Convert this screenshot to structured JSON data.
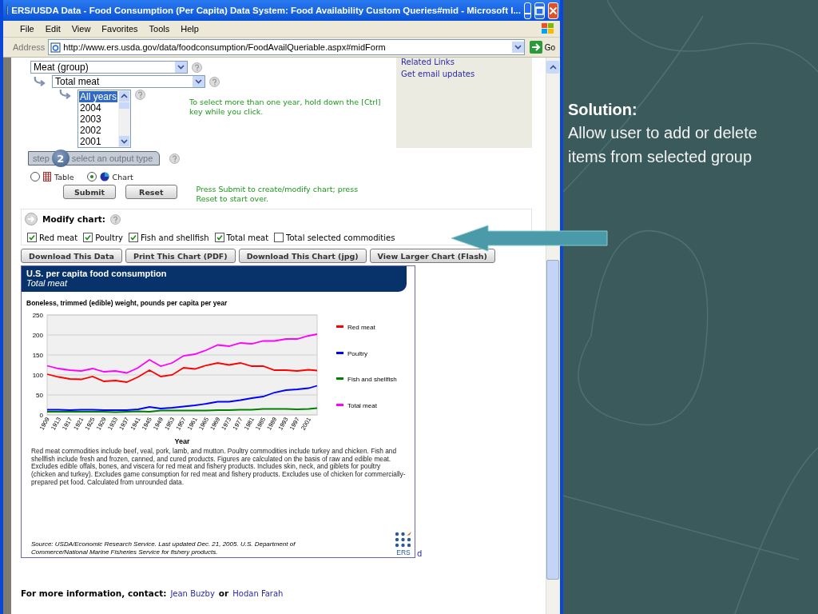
{
  "browser": {
    "title": "ERS/USDA Data - Food Consumption (Per Capita) Data System: Food Availability Custom Queries#mid - Microsoft I...",
    "menu": [
      "File",
      "Edit",
      "View",
      "Favorites",
      "Tools",
      "Help"
    ],
    "address_label": "Address",
    "url": "http://www.ers.usda.gov/data/foodconsumption/FoodAvailQueriable.aspx#midForm",
    "go_label": "Go"
  },
  "query": {
    "group_select": "Meat (group)",
    "commodity_select": "Total meat",
    "years": [
      {
        "label": "All years",
        "selected": true
      },
      {
        "label": "2004",
        "selected": false
      },
      {
        "label": "2003",
        "selected": false
      },
      {
        "label": "2002",
        "selected": false
      },
      {
        "label": "2001",
        "selected": false
      }
    ],
    "years_hint": "To select more than one year, hold down the [Ctrl] key while you click."
  },
  "sidebar_links": [
    "Related Links",
    "Get email updates"
  ],
  "step": {
    "word": "step",
    "number": "2",
    "label": "select an output type"
  },
  "output_types": [
    {
      "kind": "table",
      "label": "Table",
      "selected": false
    },
    {
      "kind": "chart",
      "label": "Chart",
      "selected": true
    }
  ],
  "form_buttons": [
    "Submit",
    "Reset"
  ],
  "submit_hint": "Press Submit to create/modify chart; press Reset to start over.",
  "modify_chart": {
    "title": "Modify chart:",
    "items": [
      {
        "label": "Red meat",
        "checked": true
      },
      {
        "label": "Poultry",
        "checked": true
      },
      {
        "label": "Fish and shellfish",
        "checked": true
      },
      {
        "label": "Total meat",
        "checked": true
      },
      {
        "label": "Total selected commodities",
        "checked": false
      }
    ]
  },
  "chart_buttons": [
    "Download This Data",
    "Print This Chart (PDF)",
    "Download This Chart (jpg)",
    "View Larger Chart (Flash)"
  ],
  "chart_card": {
    "title": "U.S. per capita food consumption",
    "subtitle": "Total meat",
    "unit_note": "Boneless, trimmed (edible) weight, pounds per capita per year",
    "chart_data": {
      "type": "line",
      "xlabel": "Year",
      "xlim": [
        1909,
        2004
      ],
      "grid": true,
      "legend": true,
      "x": [
        1909,
        1913,
        1917,
        1921,
        1925,
        1929,
        1933,
        1937,
        1941,
        1945,
        1949,
        1953,
        1957,
        1961,
        1965,
        1969,
        1973,
        1977,
        1981,
        1985,
        1989,
        1993,
        1997,
        2001,
        2004
      ],
      "ylim": [
        0,
        250
      ],
      "yticks": [
        0,
        50,
        100,
        150,
        200,
        250
      ],
      "xticks": [
        1909,
        1913,
        1917,
        1921,
        1925,
        1929,
        1933,
        1937,
        1941,
        1945,
        1949,
        1953,
        1957,
        1961,
        1965,
        1969,
        1973,
        1977,
        1981,
        1985,
        1989,
        1993,
        1997,
        2001
      ],
      "series": [
        {
          "name": "Red meat",
          "color": "#ff0000",
          "values": [
            102,
            95,
            90,
            89,
            96,
            84,
            86,
            82,
            95,
            112,
            96,
            100,
            118,
            115,
            124,
            130,
            125,
            130,
            122,
            122,
            112,
            112,
            110,
            113,
            111
          ]
        },
        {
          "name": "Poultry",
          "color": "#0000ff",
          "values": [
            13,
            13,
            12,
            13,
            13,
            12,
            12,
            12,
            14,
            20,
            16,
            18,
            21,
            24,
            28,
            33,
            33,
            37,
            42,
            46,
            56,
            62,
            64,
            67,
            73
          ]
        },
        {
          "name": "Fish and shellfish",
          "color": "#008000",
          "values": [
            8,
            8,
            8,
            8,
            8,
            8,
            7,
            8,
            9,
            8,
            11,
            11,
            11,
            11,
            11,
            12,
            12,
            13,
            13,
            15,
            15,
            15,
            14,
            15,
            17
          ]
        },
        {
          "name": "Total meat",
          "color": "#ff00ff",
          "values": [
            123,
            116,
            112,
            110,
            116,
            108,
            110,
            105,
            118,
            138,
            122,
            130,
            148,
            152,
            162,
            175,
            172,
            180,
            178,
            185,
            185,
            190,
            190,
            198,
            202
          ]
        }
      ]
    },
    "notes": "Red meat commodities include beef, veal, pork, lamb, and mutton.  Poultry commodities include turkey and chicken.  Fish and shellfish include fresh and frozen, canned, and cured products. Figures are calculated on the basis of raw and edible meat. Excludes edible offals, bones, and viscera for red meat and fishery products. Includes skin, neck, and giblets for poultry (chicken and turkey). Excludes game consumption for red meat and fishery products.   Excludes use of chicken for commercially-prepared pet food.  Calculated from unrounded data.",
    "source": "Source: USDA/Economic Research Service. Last updated Dec. 21, 2005. U.S. Department of Commerce/National Marine Fisheries Service for fishery products.",
    "logo_text": "ERS",
    "trailing_text": "d"
  },
  "contact": {
    "label": "For more information, contact:",
    "names": [
      "Jean Buzby",
      "Hodan Farah"
    ],
    "joiner": "or"
  },
  "slide": {
    "heading": "Solution:",
    "body": "Allow user to add or delete items from selected group"
  }
}
